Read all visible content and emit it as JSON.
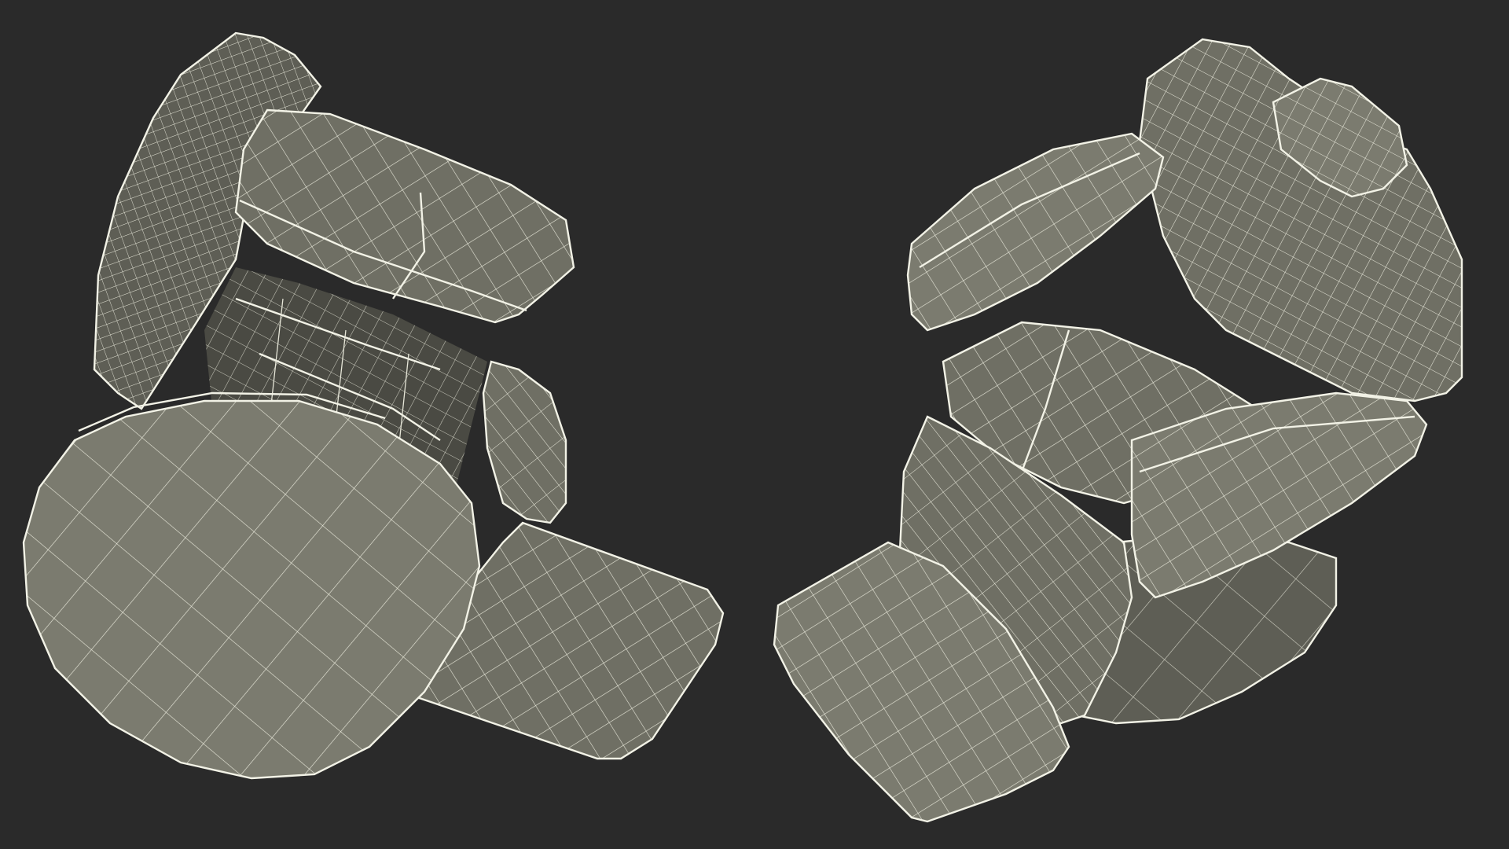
{
  "scene": {
    "background_color": "#2a2a2a",
    "wireframe_color": "#e6e6d8",
    "surface_color": "#6f6f64",
    "objects": [
      {
        "id": "chair-view-bottom",
        "description_icon": "chair-wireframe-icon"
      },
      {
        "id": "chair-view-top",
        "description_icon": "chair-wireframe-icon"
      }
    ]
  }
}
